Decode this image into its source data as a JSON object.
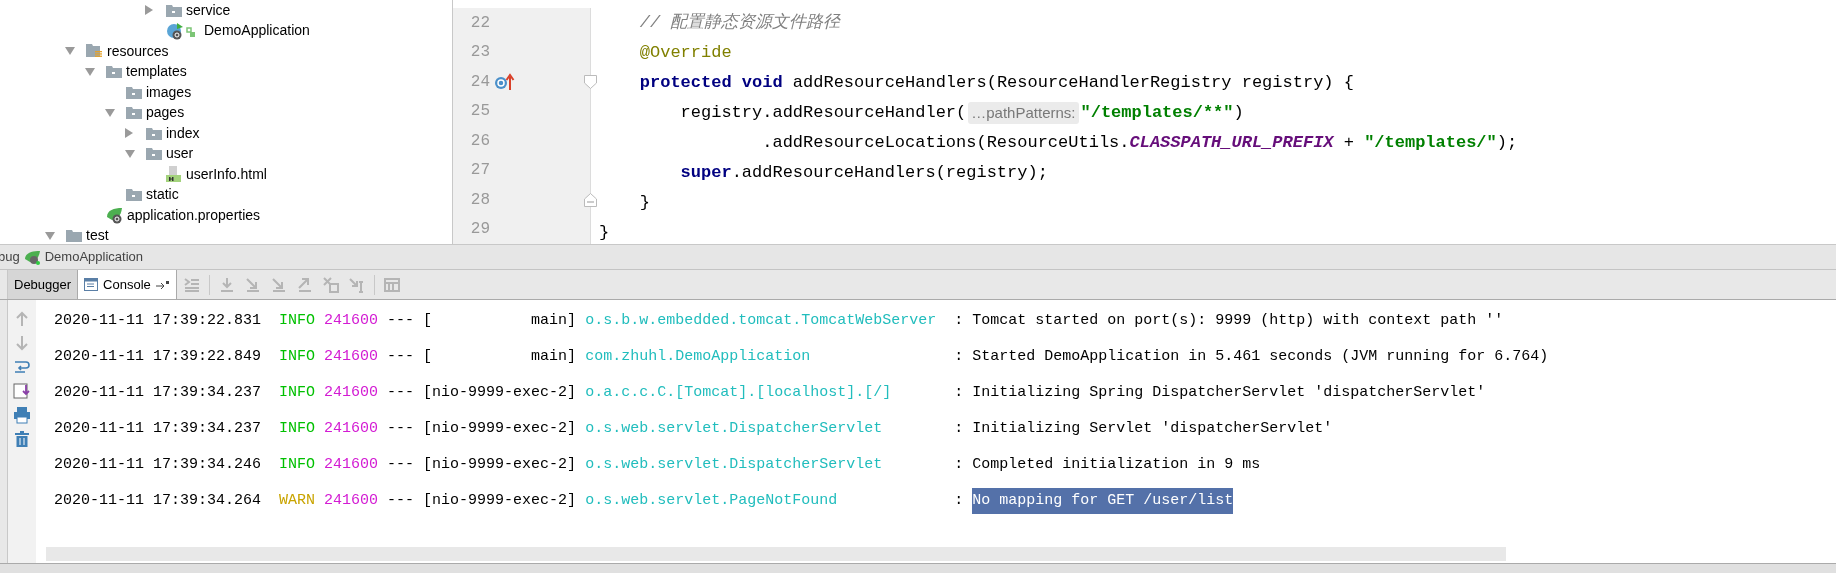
{
  "project_tree": [
    {
      "children": [
        {
          "children": [
            {
              "children": [
                {
                  "children": [
                    {
                      "children": [
                        {
                          "label": "service",
                          "kind": "package",
                          "expanded": false
                        },
                        {
                          "label": "DemoApplication",
                          "kind": "spring-class"
                        }
                      ]
                    }
                  ]
                }
              ]
            }
          ]
        },
        {
          "label": "resources",
          "kind": "resources-root",
          "expanded": true,
          "children": [
            {
              "label": "templates",
              "kind": "folder",
              "expanded": true,
              "children": [
                {
                  "label": "images",
                  "kind": "folder"
                },
                {
                  "label": "pages",
                  "kind": "folder",
                  "expanded": true,
                  "children": [
                    {
                      "label": "index",
                      "kind": "folder",
                      "expanded": false
                    },
                    {
                      "label": "user",
                      "kind": "folder",
                      "expanded": true,
                      "children": [
                        {
                          "label": "userInfo.html",
                          "kind": "html-file"
                        }
                      ]
                    }
                  ]
                },
                {
                  "label": "static",
                  "kind": "folder"
                }
              ]
            },
            {
              "label": "application.properties",
              "kind": "spring-config"
            }
          ]
        }
      ]
    },
    {
      "label": "test",
      "kind": "source-folder",
      "expanded": true
    }
  ],
  "editor": {
    "lines": [
      {
        "number": "22",
        "tokens": [
          {
            "kind": "comment",
            "text": "    // 配置静态资源文件路径"
          }
        ]
      },
      {
        "number": "23",
        "tokens": [
          {
            "kind": "annotation",
            "text": "    @Override"
          }
        ]
      },
      {
        "number": "24",
        "override_marker": true,
        "fold_start": true,
        "tokens": [
          {
            "kind": "keyword",
            "text": "    protected"
          },
          {
            "kind": "keyword",
            "text": " void"
          },
          {
            "kind": "plain",
            "text": " addResourceHandlers(ResourceHandlerRegistry registry) {"
          }
        ]
      },
      {
        "number": "25",
        "tokens": [
          {
            "kind": "plain",
            "text": "        registry.addResourceHandler("
          },
          {
            "kind": "hint",
            "text": "…pathPatterns:"
          },
          {
            "kind": "string",
            "text": "\"/templates/**\""
          },
          {
            "kind": "plain",
            "text": ")"
          }
        ]
      },
      {
        "number": "26",
        "tokens": [
          {
            "kind": "plain",
            "text": "                .addResourceLocations(ResourceUtils."
          },
          {
            "kind": "constant",
            "text": "CLASSPATH_URL_PREFIX"
          },
          {
            "kind": "plain",
            "text": " + "
          },
          {
            "kind": "string",
            "text": "\"/templates/\""
          },
          {
            "kind": "plain",
            "text": ");"
          }
        ]
      },
      {
        "number": "27",
        "tokens": [
          {
            "kind": "keyword",
            "text": "        super"
          },
          {
            "kind": "plain",
            "text": ".addResourceHandlers(registry);"
          }
        ]
      },
      {
        "number": "28",
        "fold_end": true,
        "tokens": [
          {
            "kind": "plain",
            "text": "    }"
          }
        ]
      },
      {
        "number": "29",
        "tokens": [
          {
            "kind": "plain",
            "text": "}"
          }
        ]
      }
    ]
  },
  "run_bar": {
    "cut_label": "bug",
    "configuration": "DemoApplication"
  },
  "debug_tabs": [
    {
      "label": "Debugger",
      "selected": false
    },
    {
      "label": "Console",
      "selected": true
    }
  ],
  "console": {
    "rows": [
      {
        "timestamp": "2020-11-11 17:39:22.831",
        "level": "INFO",
        "color": "#00c000",
        "pid": "241600",
        "dashes": "---",
        "thread": "[           main]",
        "logger": "o.s.b.w.embedded.tomcat.TomcatWebServer",
        "separator": ":",
        "message": "Tomcat started on port(s): 9999 (http) with context path ''",
        "selected": false
      },
      {
        "timestamp": "2020-11-11 17:39:22.849",
        "level": "INFO",
        "color": "#00c000",
        "pid": "241600",
        "dashes": "---",
        "thread": "[           main]",
        "logger": "com.zhuhl.DemoApplication",
        "separator": ":",
        "message": "Started DemoApplication in 5.461 seconds (JVM running for 6.764)",
        "selected": false
      },
      {
        "timestamp": "2020-11-11 17:39:34.237",
        "level": "INFO",
        "color": "#00c000",
        "pid": "241600",
        "dashes": "---",
        "thread": "[nio-9999-exec-2]",
        "logger": "o.a.c.c.C.[Tomcat].[localhost].[/]",
        "separator": ":",
        "message": "Initializing Spring DispatcherServlet 'dispatcherServlet'",
        "selected": false
      },
      {
        "timestamp": "2020-11-11 17:39:34.237",
        "level": "INFO",
        "color": "#00c000",
        "pid": "241600",
        "dashes": "---",
        "thread": "[nio-9999-exec-2]",
        "logger": "o.s.web.servlet.DispatcherServlet",
        "separator": ":",
        "message": "Initializing Servlet 'dispatcherServlet'",
        "selected": false
      },
      {
        "timestamp": "2020-11-11 17:39:34.246",
        "level": "INFO",
        "color": "#00c000",
        "pid": "241600",
        "dashes": "---",
        "thread": "[nio-9999-exec-2]",
        "logger": "o.s.web.servlet.DispatcherServlet",
        "separator": ":",
        "message": "Completed initialization in 9 ms",
        "selected": false
      },
      {
        "timestamp": "2020-11-11 17:39:34.264",
        "level": "WARN",
        "color": "#c9a400",
        "pid": "241600",
        "dashes": "---",
        "thread": "[nio-9999-exec-2]",
        "logger": "o.s.web.servlet.PageNotFound",
        "separator": ":",
        "message": "No mapping for GET /user/list",
        "selected": true
      }
    ]
  }
}
